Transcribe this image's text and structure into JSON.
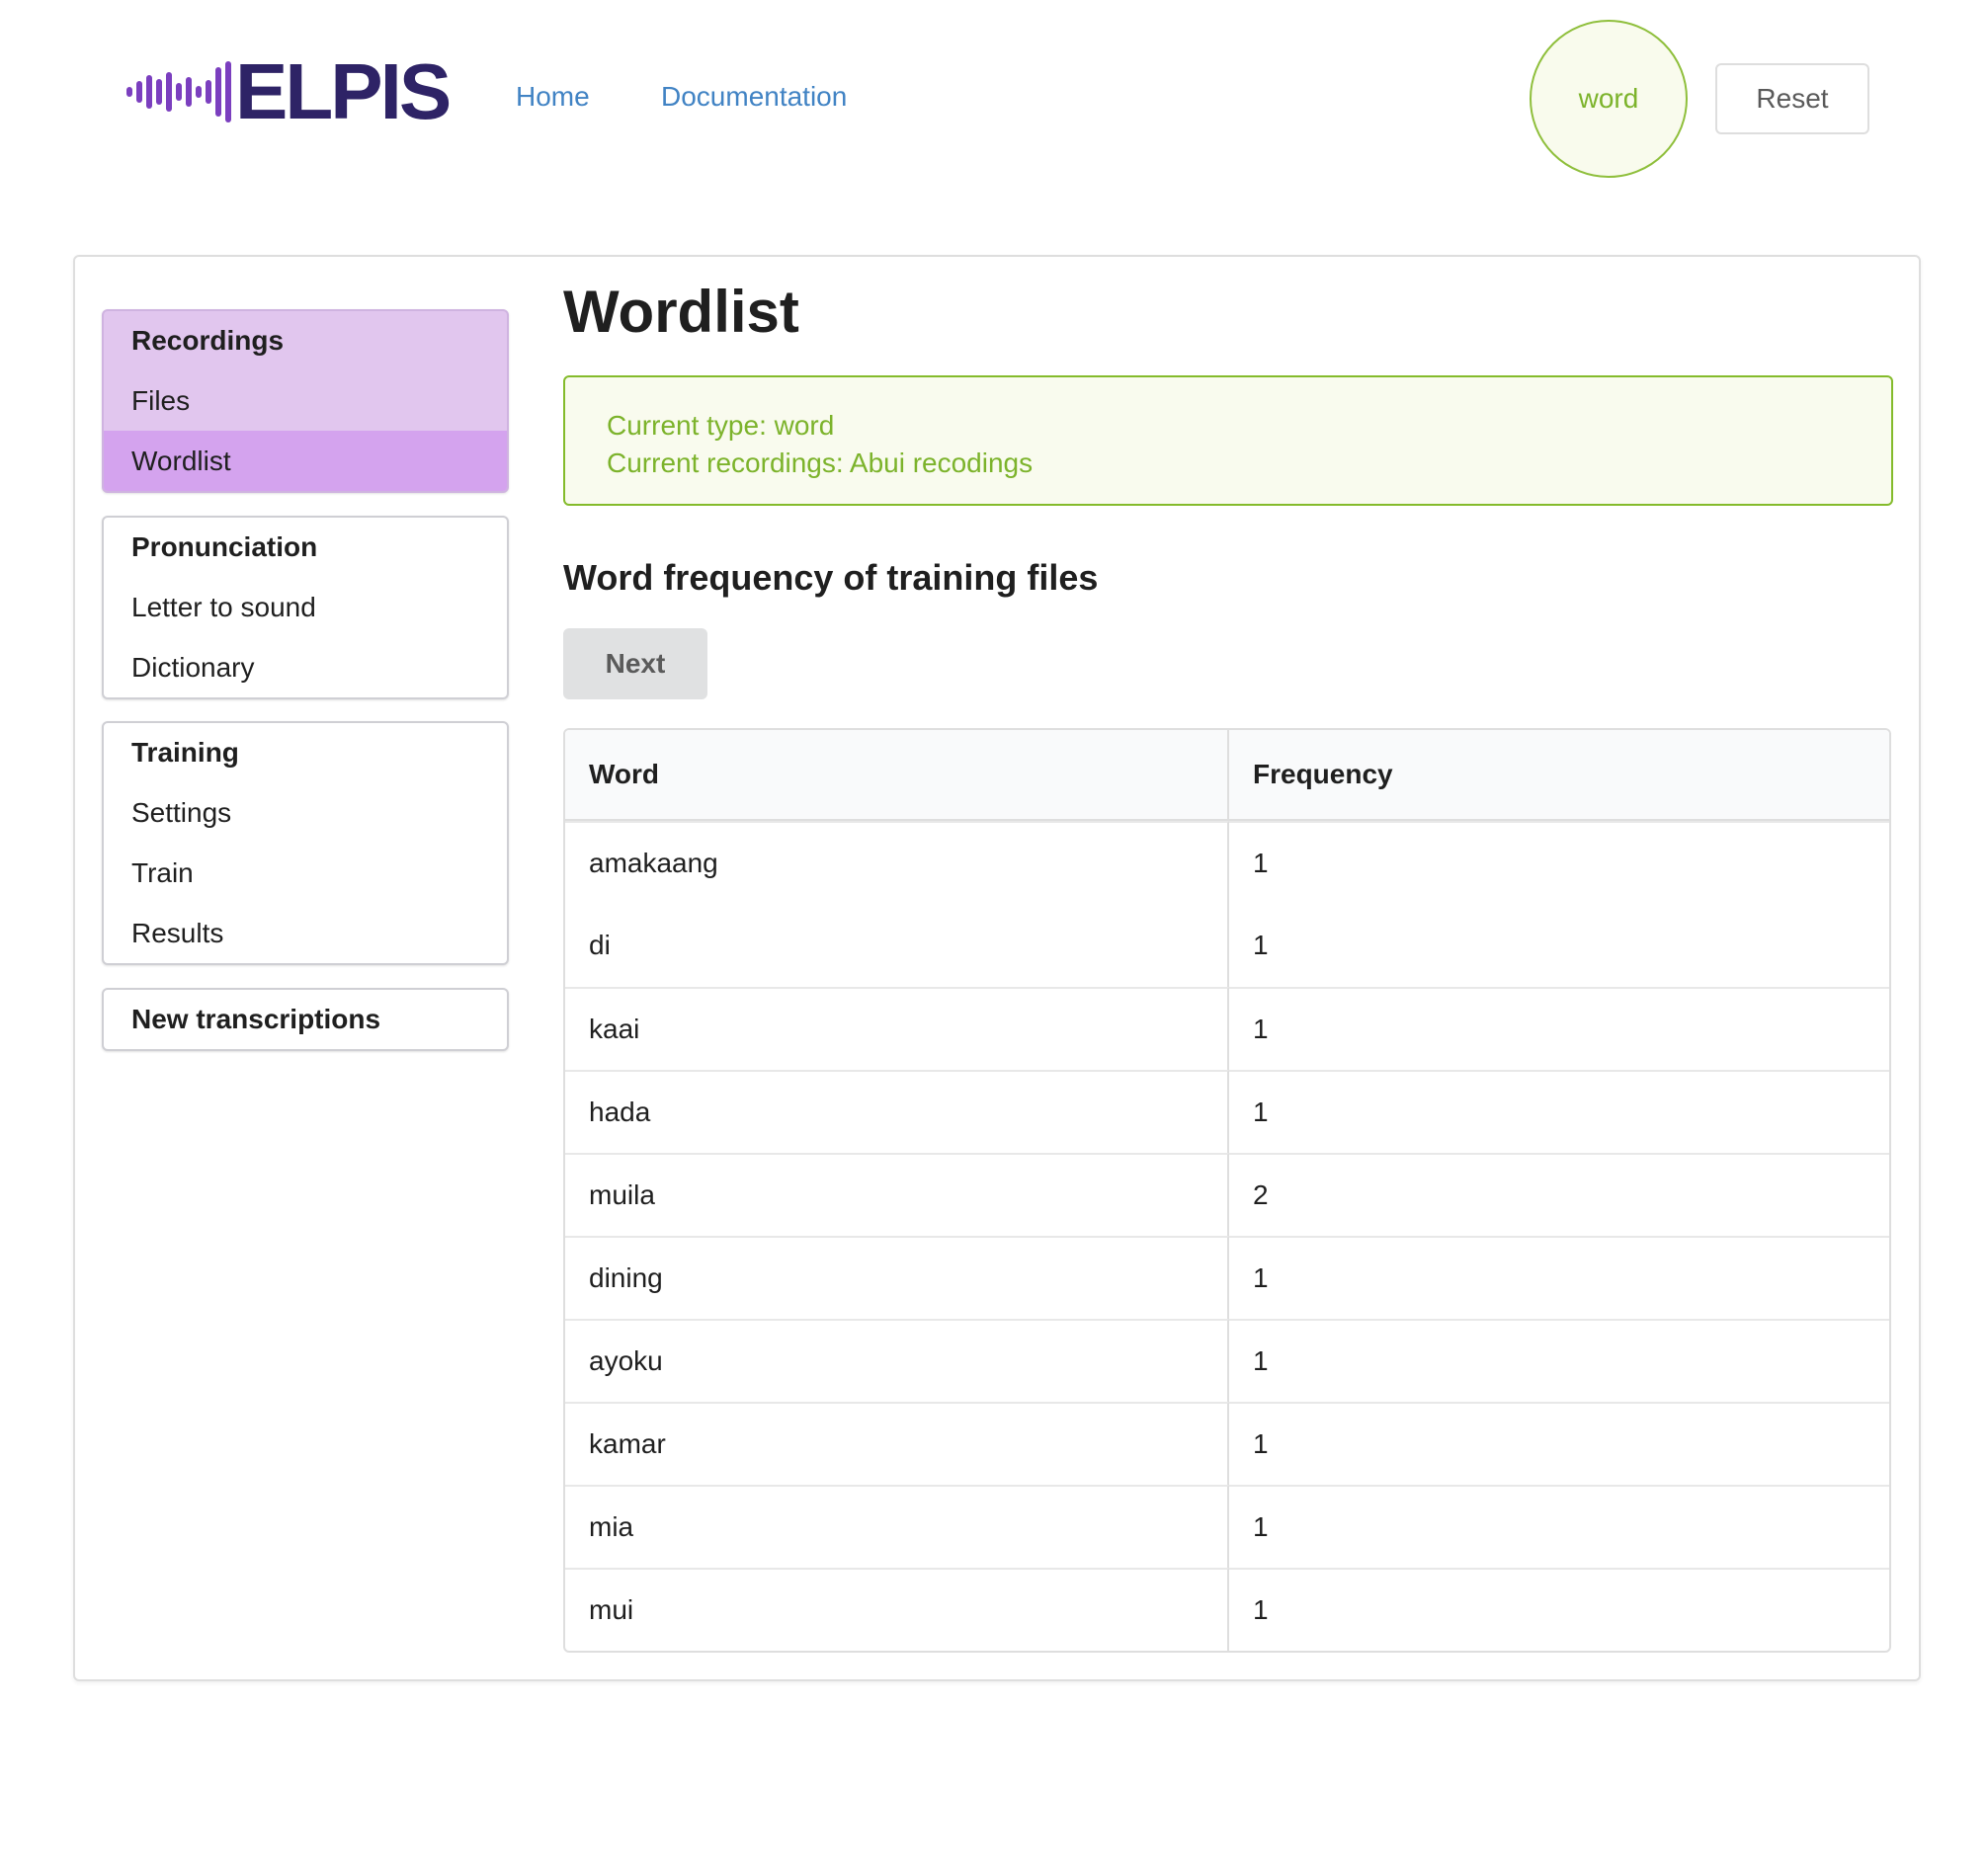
{
  "app": {
    "logo_text": "ELPIS",
    "nav": [
      {
        "label": "Home"
      },
      {
        "label": "Documentation"
      }
    ],
    "type_badge": "word",
    "reset_label": "Reset"
  },
  "sidebar": {
    "groups": [
      {
        "title": "Recordings",
        "items": [
          "Files",
          "Wordlist"
        ],
        "active_item": "Wordlist"
      },
      {
        "title": "Pronunciation",
        "items": [
          "Letter to sound",
          "Dictionary"
        ]
      },
      {
        "title": "Training",
        "items": [
          "Settings",
          "Train",
          "Results"
        ]
      },
      {
        "title": "New transcriptions",
        "items": []
      }
    ]
  },
  "main": {
    "title": "Wordlist",
    "info": {
      "current_type": "Current type: word",
      "current_recordings": "Current recordings: Abui recodings"
    },
    "section_heading": "Word frequency of training files",
    "next_label": "Next",
    "table": {
      "headers": [
        "Word",
        "Frequency"
      ],
      "rows": [
        [
          "amakaang",
          "1"
        ],
        [
          "di",
          "1"
        ],
        [
          "kaai",
          "1"
        ],
        [
          "hada",
          "1"
        ],
        [
          "muila",
          "2"
        ],
        [
          "dining",
          "1"
        ],
        [
          "ayoku",
          "1"
        ],
        [
          "kamar",
          "1"
        ],
        [
          "mia",
          "1"
        ],
        [
          "mui",
          "1"
        ]
      ]
    }
  },
  "colors": {
    "accent_purple": "#d4a3ee",
    "recordings_bg": "#e1c6ee",
    "link_blue": "#4183c4",
    "info_green": "#7cb32b"
  }
}
